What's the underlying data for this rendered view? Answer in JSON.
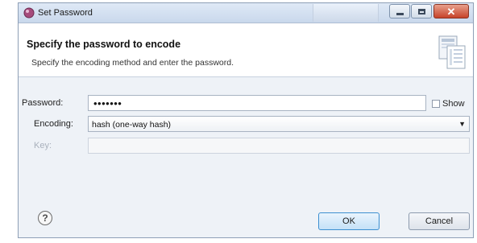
{
  "window": {
    "title": "Set Password"
  },
  "header": {
    "title": "Specify the password to encode",
    "description": "Specify the encoding method and enter the password."
  },
  "form": {
    "password_label": "Password:",
    "password_value": "•••••••",
    "show_label": "Show",
    "show_checked": false,
    "encoding_label": "Encoding:",
    "encoding_value": "hash (one-way hash)",
    "key_label": "Key:",
    "key_value": ""
  },
  "buttons": {
    "help": "?",
    "ok": "OK",
    "cancel": "Cancel"
  },
  "icons": {
    "app": "set-password-icon",
    "header_image": "document-wizard-icon",
    "combo_arrow": "chevron-down-icon",
    "help": "help-icon"
  },
  "colors": {
    "ok_border": "#3c8fd0",
    "close_button": "#c7432a"
  }
}
